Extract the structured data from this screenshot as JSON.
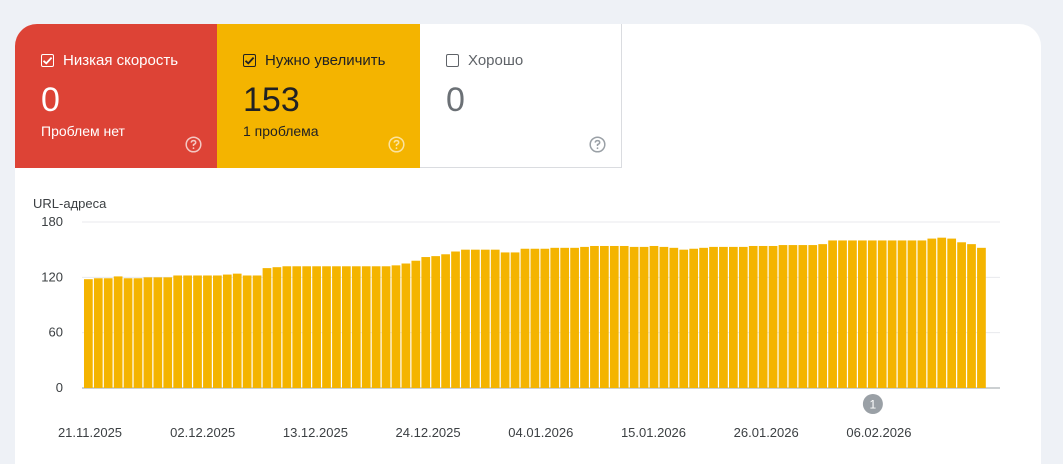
{
  "summary_tiles": [
    {
      "label": "Низкая скорость",
      "value": "0",
      "sub": "Проблем нет",
      "checked": true,
      "color": "#dd4336"
    },
    {
      "label": "Нужно увеличить",
      "value": "153",
      "sub": "1 проблема",
      "checked": true,
      "color": "#f4b400"
    },
    {
      "label": "Хорошо",
      "value": "0",
      "sub": "",
      "checked": false,
      "color": "#ffffff"
    }
  ],
  "icons": {
    "checkbox": "checkbox-icon",
    "help": "help-circle-icon",
    "annotation": "annotation-marker"
  },
  "chart_data": {
    "type": "bar",
    "ylabel": "URL-адреса",
    "ylim": [
      0,
      180
    ],
    "yticks": [
      "180",
      "120",
      "60",
      "0"
    ],
    "grid": true,
    "bar_color": "#f4b400",
    "xtick_labels": [
      "21.11.2025",
      "02.12.2025",
      "13.12.2025",
      "24.12.2025",
      "04.01.2026",
      "15.01.2026",
      "26.01.2026",
      "06.02.2026"
    ],
    "annotation": {
      "label": "1",
      "date": "09.02.2026"
    },
    "values": [
      118,
      119,
      119,
      121,
      119,
      119,
      120,
      120,
      120,
      122,
      122,
      122,
      122,
      122,
      123,
      124,
      122,
      122,
      130,
      131,
      132,
      132,
      132,
      132,
      132,
      132,
      132,
      132,
      132,
      132,
      132,
      133,
      135,
      138,
      142,
      143,
      145,
      148,
      150,
      150,
      150,
      150,
      147,
      147,
      151,
      151,
      151,
      152,
      152,
      152,
      153,
      154,
      154,
      154,
      154,
      153,
      153,
      154,
      153,
      152,
      150,
      151,
      152,
      153,
      153,
      153,
      153,
      154,
      154,
      154,
      155,
      155,
      155,
      155,
      156,
      160,
      160,
      160,
      160,
      160,
      160,
      160,
      160,
      160,
      160,
      162,
      163,
      162,
      158,
      156,
      152
    ]
  }
}
